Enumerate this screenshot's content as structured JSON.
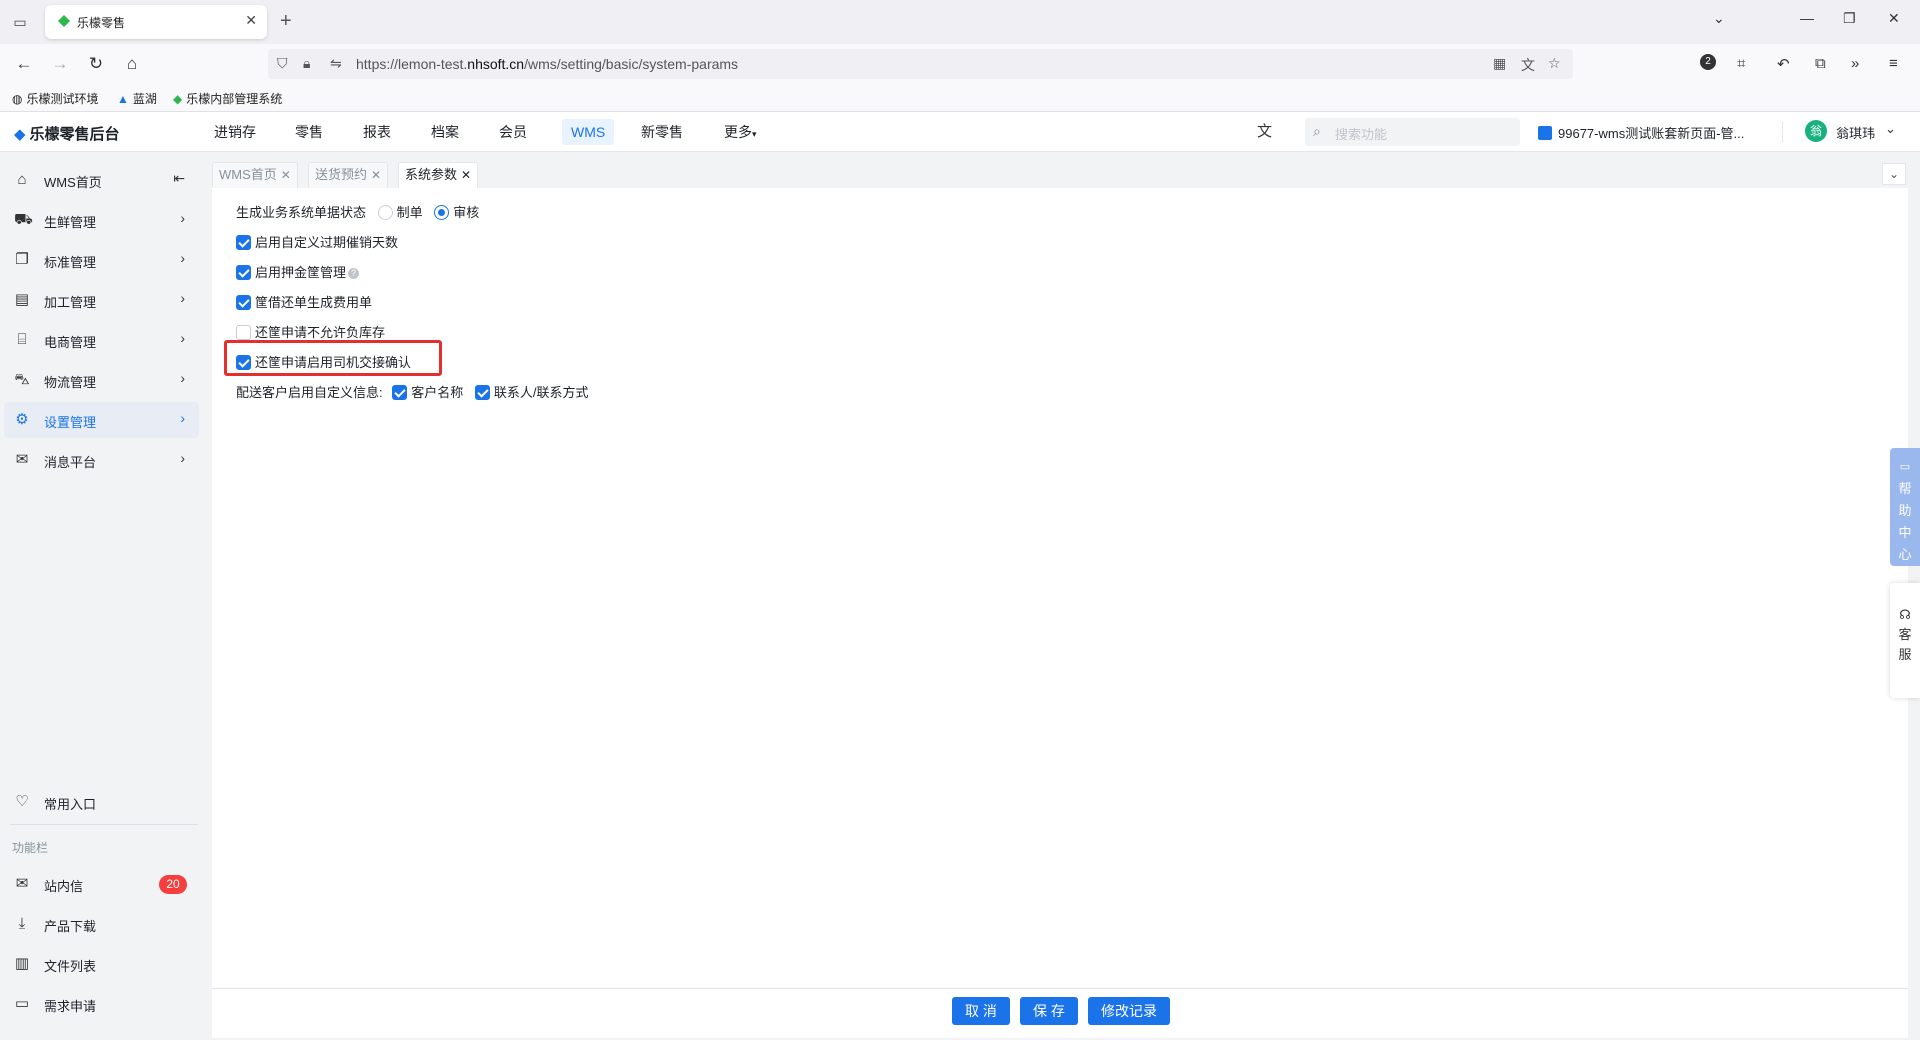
{
  "browser": {
    "tab_title": "乐檬零售",
    "url_prefix": "https://lemon-test.",
    "url_domain": "nhsoft.cn",
    "url_path": "/wms/setting/basic/system-params",
    "badge_count": "2",
    "bookmarks": [
      "乐檬测试环境",
      "蓝湖",
      "乐檬内部管理系统"
    ]
  },
  "app": {
    "logo_text": "乐檬零售后台",
    "topnav": [
      "进销存",
      "零售",
      "报表",
      "档案",
      "会员",
      "WMS",
      "新零售",
      "更多"
    ],
    "active_nav": "WMS",
    "search_placeholder": "搜索功能",
    "shop_name": "99677-wms测试账套新页面-管...",
    "avatar_text": "翁",
    "user_name": "翁琪玮"
  },
  "sidebar": {
    "items": [
      {
        "label": "WMS首页",
        "icon": "home-icon"
      },
      {
        "label": "生鲜管理",
        "icon": "basket-icon"
      },
      {
        "label": "标准管理",
        "icon": "copy-icon"
      },
      {
        "label": "加工管理",
        "icon": "doc-icon"
      },
      {
        "label": "电商管理",
        "icon": "store-icon"
      },
      {
        "label": "物流管理",
        "icon": "truck-icon"
      },
      {
        "label": "设置管理",
        "icon": "settings-icon"
      },
      {
        "label": "消息平台",
        "icon": "mail-icon"
      }
    ],
    "active": "设置管理",
    "favorites_label": "常用入口",
    "section_label": "功能栏",
    "tools": [
      {
        "label": "站内信",
        "icon": "inbox-icon",
        "badge": "20"
      },
      {
        "label": "产品下载",
        "icon": "download-icon"
      },
      {
        "label": "文件列表",
        "icon": "chart-icon"
      },
      {
        "label": "需求申请",
        "icon": "message-icon"
      }
    ]
  },
  "page_tabs": [
    {
      "label": "WMS首页",
      "active": false
    },
    {
      "label": "送货预约",
      "active": false
    },
    {
      "label": "系统参数",
      "active": true
    }
  ],
  "settings": {
    "status_label": "生成业务系统单据状态",
    "status_options": [
      {
        "label": "制单",
        "checked": false
      },
      {
        "label": "审核",
        "checked": true
      }
    ],
    "checkboxes": [
      {
        "label": "启用自定义过期催销天数",
        "checked": true
      },
      {
        "label": "启用押金筐管理",
        "checked": true,
        "help": true
      },
      {
        "label": "筐借还单生成费用单",
        "checked": true
      },
      {
        "label": "还筐申请不允许负库存",
        "checked": false
      },
      {
        "label": "还筐申请启用司机交接确认",
        "checked": true,
        "highlighted": true
      }
    ],
    "delivery_label": "配送客户启用自定义信息:",
    "delivery_options": [
      {
        "label": "客户名称",
        "checked": true
      },
      {
        "label": "联系人/联系方式",
        "checked": true
      }
    ]
  },
  "footer": {
    "cancel": "取 消",
    "save": "保 存",
    "history": "修改记录"
  },
  "widgets": {
    "help_center": [
      "帮",
      "助",
      "中",
      "心"
    ],
    "service": [
      "客",
      "服"
    ]
  },
  "colors": {
    "primary": "#1a73e8",
    "highlight": "#e52f2f",
    "badge": "#f53f3f"
  }
}
